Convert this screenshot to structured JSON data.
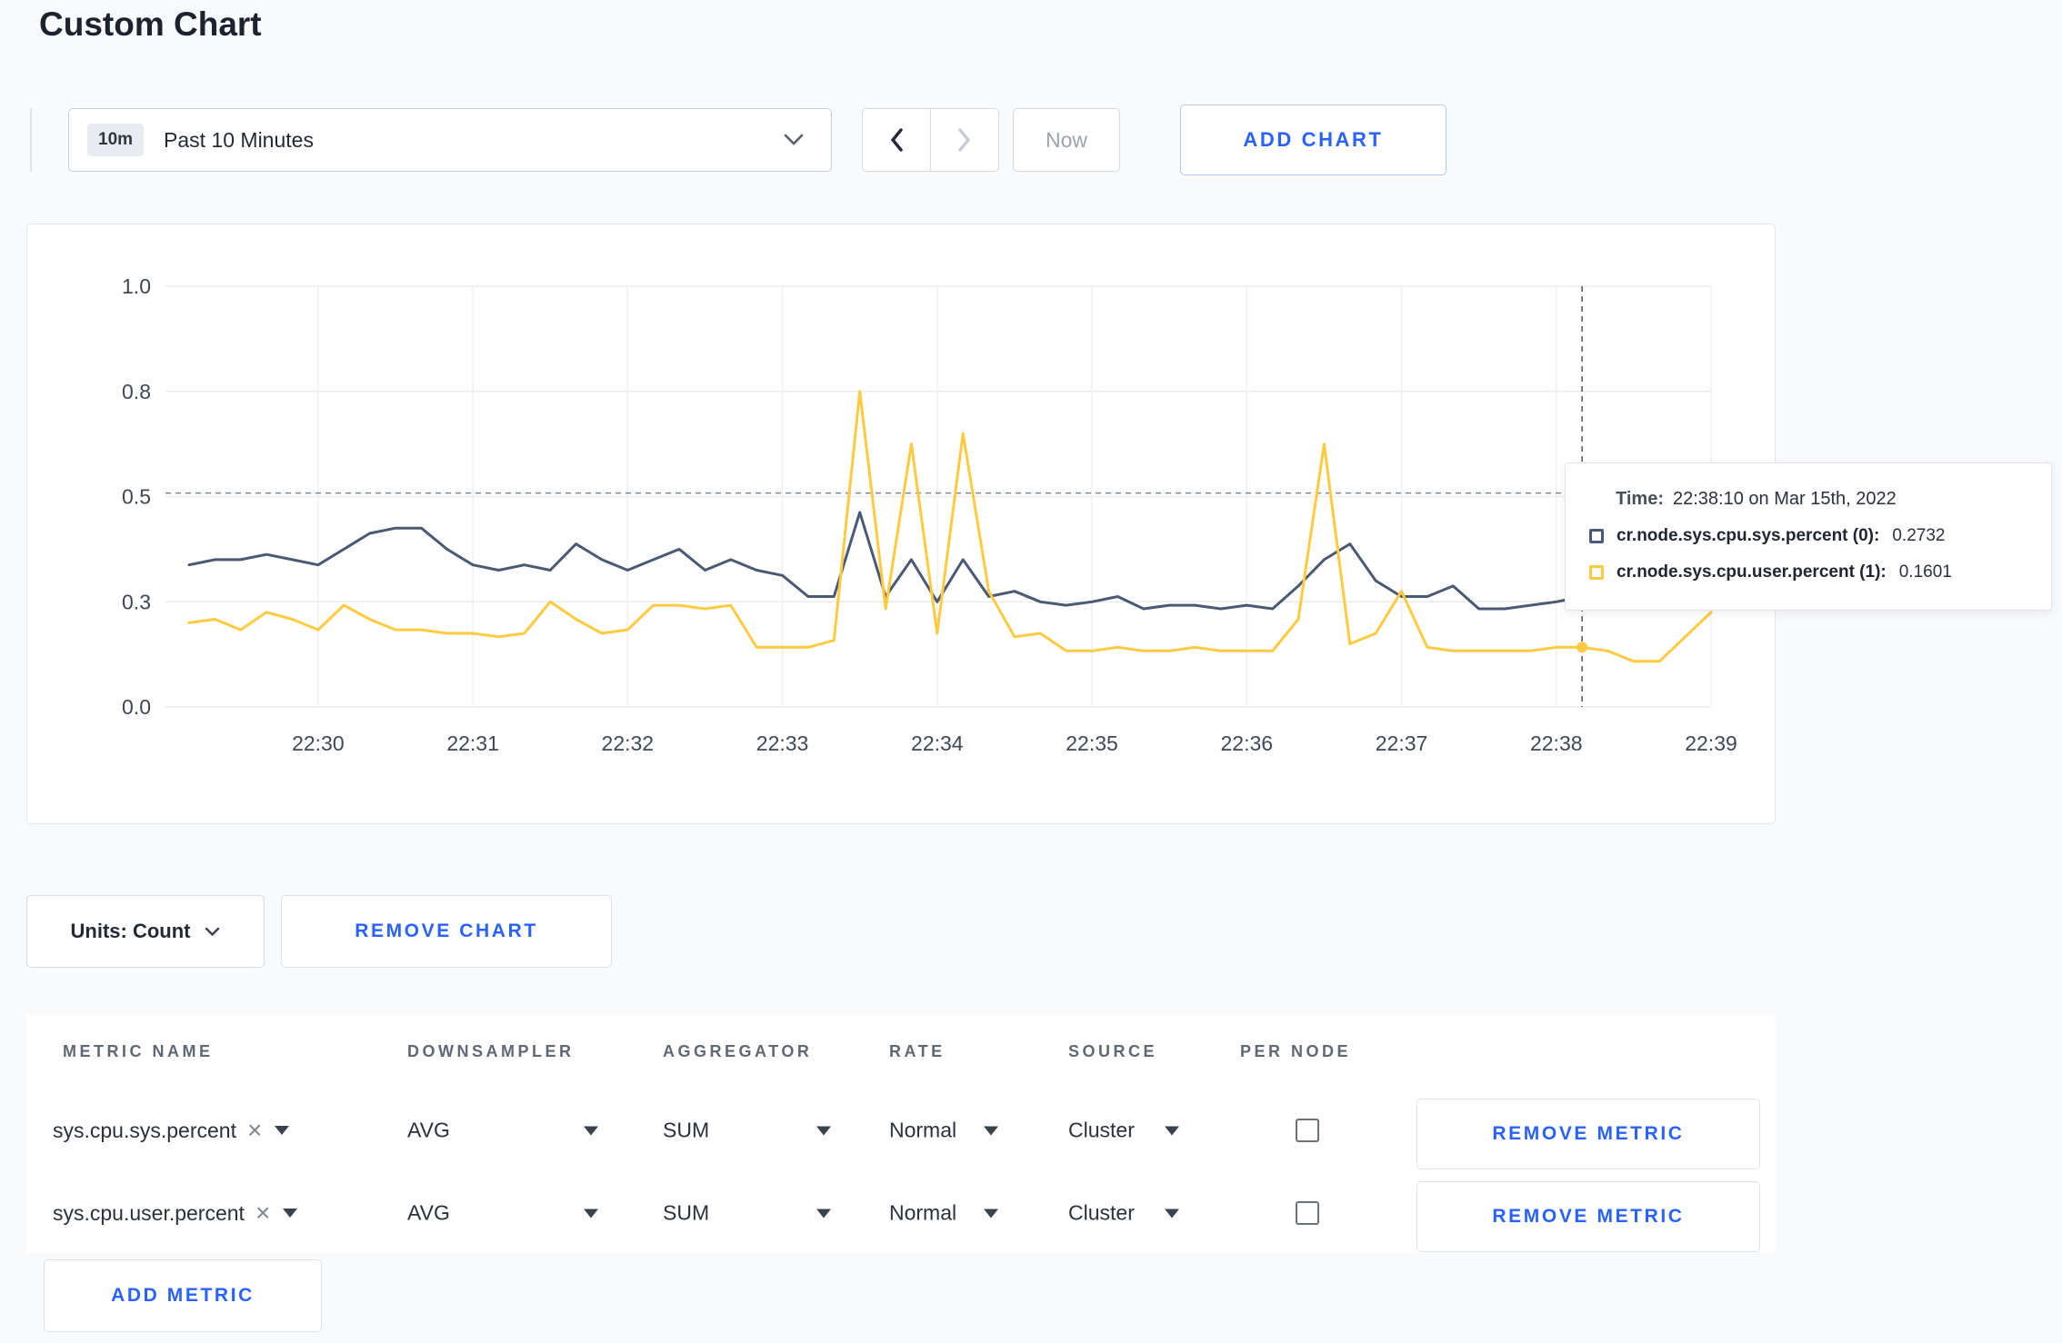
{
  "page": {
    "title": "Custom Chart"
  },
  "toolbar": {
    "time_range": {
      "badge": "10m",
      "label": "Past 10 Minutes"
    },
    "now_label": "Now",
    "add_chart_label": "ADD CHART"
  },
  "chart_data": {
    "type": "line",
    "title": "",
    "xlabel": "",
    "ylabel": "",
    "grid": true,
    "ylim": [
      0,
      1.0
    ],
    "y_ticks": [
      "1.0",
      "0.8",
      "0.5",
      "0.3",
      "0.0"
    ],
    "y_tick_values": [
      1.0,
      0.8,
      0.5,
      0.3,
      0.0
    ],
    "x_ticks": [
      "22:30",
      "22:31",
      "22:32",
      "22:33",
      "22:34",
      "22:35",
      "22:36",
      "22:37",
      "22:38",
      "22:39"
    ],
    "x_tick_indices": [
      5,
      11,
      17,
      23,
      29,
      35,
      41,
      47,
      53,
      59
    ],
    "x_start_time": "22:29:10",
    "x_step_seconds": 10,
    "series": [
      {
        "name": "cr.node.sys.cpu.sys.percent",
        "color": "#4a5a74",
        "values": [
          0.37,
          0.38,
          0.38,
          0.39,
          0.38,
          0.37,
          0.4,
          0.43,
          0.44,
          0.44,
          0.4,
          0.37,
          0.36,
          0.37,
          0.36,
          0.41,
          0.38,
          0.36,
          0.38,
          0.4,
          0.36,
          0.38,
          0.36,
          0.35,
          0.31,
          0.31,
          0.47,
          0.31,
          0.38,
          0.3,
          0.38,
          0.31,
          0.32,
          0.3,
          0.29,
          0.3,
          0.31,
          0.28,
          0.29,
          0.29,
          0.28,
          0.29,
          0.28,
          0.33,
          0.38,
          0.41,
          0.34,
          0.31,
          0.31,
          0.33,
          0.28,
          0.28,
          0.29,
          0.3,
          0.31,
          0.29,
          0.3,
          0.3,
          0.3,
          0.31
        ]
      },
      {
        "name": "cr.node.sys.cpu.user.percent",
        "color": "#fdca40",
        "values": [
          0.24,
          0.25,
          0.22,
          0.27,
          0.25,
          0.22,
          0.29,
          0.25,
          0.22,
          0.22,
          0.21,
          0.21,
          0.2,
          0.21,
          0.3,
          0.25,
          0.21,
          0.22,
          0.29,
          0.29,
          0.28,
          0.29,
          0.17,
          0.17,
          0.17,
          0.19,
          0.8,
          0.28,
          0.65,
          0.21,
          0.68,
          0.32,
          0.2,
          0.21,
          0.16,
          0.16,
          0.17,
          0.16,
          0.16,
          0.17,
          0.16,
          0.16,
          0.16,
          0.25,
          0.65,
          0.18,
          0.21,
          0.32,
          0.17,
          0.16,
          0.16,
          0.16,
          0.16,
          0.17,
          0.17,
          0.16,
          0.13,
          0.13,
          0.2,
          0.27
        ]
      }
    ],
    "crosshair": {
      "index": 54,
      "time": "22:38:10",
      "h_line_value": 0.51
    }
  },
  "tooltip": {
    "time_label": "Time:",
    "time_value": "22:38:10 on Mar 15th, 2022",
    "entries": [
      {
        "label": "cr.node.sys.cpu.sys.percent (0):",
        "value": "0.2732",
        "color": "#4a5a74"
      },
      {
        "label": "cr.node.sys.cpu.user.percent (1):",
        "value": "0.1601",
        "color": "#fdca40"
      }
    ]
  },
  "controls": {
    "units_label": "Units: Count",
    "remove_chart_label": "REMOVE CHART",
    "add_metric_label": "ADD METRIC"
  },
  "metrics_table": {
    "headers": [
      "METRIC NAME",
      "DOWNSAMPLER",
      "AGGREGATOR",
      "RATE",
      "SOURCE",
      "PER NODE"
    ],
    "rows": [
      {
        "metric": "sys.cpu.sys.percent",
        "downsampler": "AVG",
        "aggregator": "SUM",
        "rate": "Normal",
        "source": "Cluster",
        "per_node_checked": false,
        "remove_label": "REMOVE METRIC"
      },
      {
        "metric": "sys.cpu.user.percent",
        "downsampler": "AVG",
        "aggregator": "SUM",
        "rate": "Normal",
        "source": "Cluster",
        "per_node_checked": false,
        "remove_label": "REMOVE METRIC"
      }
    ]
  },
  "colors": {
    "accent_blue": "#2962ff",
    "series_sys": "#4a5a74",
    "series_user": "#fdca40",
    "grid_line": "#e9ecef"
  }
}
